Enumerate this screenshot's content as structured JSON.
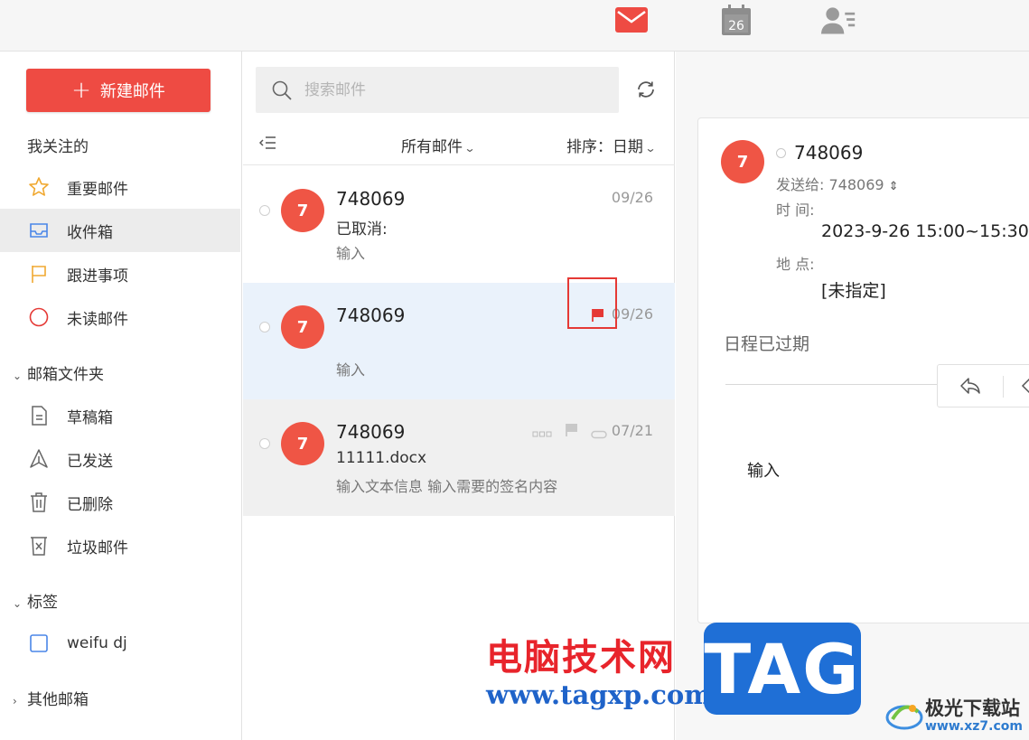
{
  "top_nav": {
    "mail_icon": "mail-icon",
    "calendar_day": "26",
    "contacts_icon": "contacts-icon",
    "accent": "#ee4b43"
  },
  "sidebar": {
    "new_mail_label": "新建邮件",
    "following_title": "我关注的",
    "following_items": [
      {
        "label": "重要邮件",
        "icon": "star-icon"
      },
      {
        "label": "收件箱",
        "icon": "inbox-icon",
        "active": true
      },
      {
        "label": "跟进事项",
        "icon": "flag-icon"
      },
      {
        "label": "未读邮件",
        "icon": "circle-icon"
      }
    ],
    "folders_title": "邮箱文件夹",
    "folder_items": [
      {
        "label": "草稿箱",
        "icon": "draft-icon"
      },
      {
        "label": "已发送",
        "icon": "sent-icon"
      },
      {
        "label": "已删除",
        "icon": "trash-icon"
      },
      {
        "label": "垃圾邮件",
        "icon": "spam-icon"
      }
    ],
    "tags_title": "标签",
    "tag_items": [
      {
        "label": "weifu dj",
        "icon": "tag-checkbox-icon"
      }
    ],
    "other_title": "其他邮箱"
  },
  "list": {
    "search_placeholder": "搜索邮件",
    "filter_label": "所有邮件",
    "sort_label": "排序：日期",
    "mails": [
      {
        "avatar": "7",
        "sender": "748069",
        "subject": "已取消:",
        "preview": "输入",
        "date": "09/26"
      },
      {
        "avatar": "7",
        "sender": "748069",
        "subject": "",
        "preview": "输入",
        "date": "09/26"
      },
      {
        "avatar": "7",
        "sender": "748069",
        "subject": "11111.docx",
        "preview": "输入文本信息 输入需要的签名内容",
        "date": "07/21"
      }
    ]
  },
  "reader": {
    "avatar": "7",
    "from": "748069",
    "to_label": "发送给: 748069",
    "time_label": "时  间:",
    "time_value": "2023-9-26 15:00~15:30",
    "place_label": "地  点:",
    "place_value": "[未指定]",
    "expired_text": "日程已过期",
    "body_text": "输入"
  },
  "watermark": {
    "cn": "电脑技术网",
    "url": "www.tagxp.com",
    "tag": "TAG",
    "site_cn": "极光下载站",
    "site_url": "www.xz7.com"
  }
}
